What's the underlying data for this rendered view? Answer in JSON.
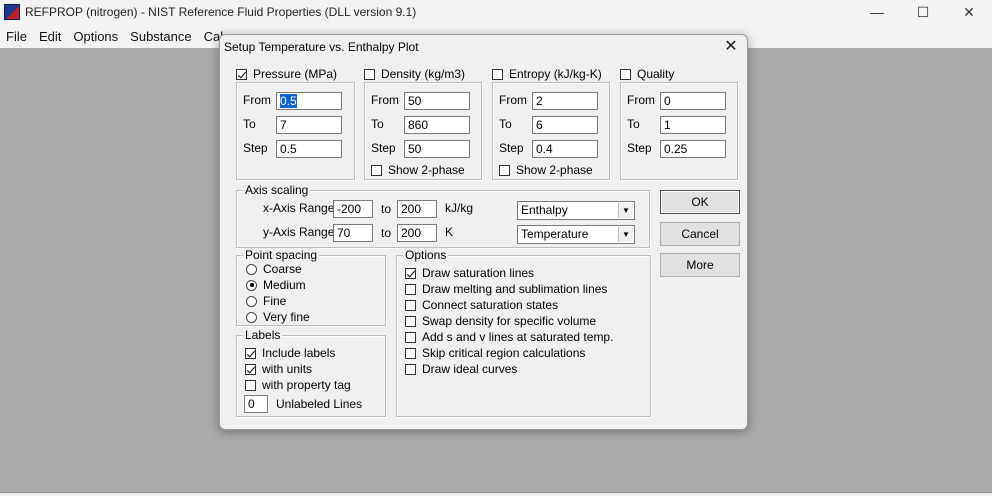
{
  "window": {
    "title": "REFPROP (nitrogen) - NIST Reference Fluid Properties (DLL version 9.1)"
  },
  "menu": [
    "File",
    "Edit",
    "Options",
    "Substance",
    "Calc"
  ],
  "dialog": {
    "title": "Setup Temperature vs. Enthalpy Plot",
    "close_label": "✕",
    "groups": {
      "pressure": {
        "label": "Pressure (MPa)",
        "checked": true,
        "from": "0.5",
        "to": "7",
        "step": "0.5"
      },
      "density": {
        "label": "Density (kg/m3)",
        "checked": false,
        "from": "50",
        "to": "860",
        "step": "50",
        "show2phase": "Show 2-phase"
      },
      "entropy": {
        "label": "Entropy (kJ/kg-K)",
        "checked": false,
        "from": "2",
        "to": "6",
        "step": "0.4",
        "show2phase": "Show 2-phase"
      },
      "quality": {
        "label": "Quality",
        "checked": false,
        "from": "0",
        "to": "1",
        "step": "0.25"
      }
    },
    "field_labels": {
      "from": "From",
      "to": "To",
      "step": "Step"
    },
    "axis": {
      "title": "Axis scaling",
      "x_label": "x-Axis Range",
      "x_from": "-200",
      "x_to": "200",
      "x_unit": "kJ/kg",
      "x_var": "Enthalpy",
      "y_label": "y-Axis Range",
      "y_from": "70",
      "y_to": "200",
      "y_unit": "K",
      "y_var": "Temperature",
      "to_word": "to"
    },
    "point_spacing": {
      "title": "Point spacing",
      "options": [
        "Coarse",
        "Medium",
        "Fine",
        "Very fine"
      ],
      "selected": "Medium"
    },
    "labels": {
      "title": "Labels",
      "include": "Include labels",
      "with_units": "with units",
      "with_tag": "with property tag",
      "unlabeled_value": "0",
      "unlabeled": "Unlabeled Lines"
    },
    "options": {
      "title": "Options",
      "items": [
        "Draw saturation lines",
        "Draw melting and sublimation lines",
        "Connect saturation states",
        "Swap density for specific volume",
        "Add s and v lines at saturated temp.",
        "Skip critical region calculations",
        "Draw ideal curves"
      ]
    },
    "buttons": {
      "ok": "OK",
      "cancel": "Cancel",
      "more": "More"
    }
  }
}
